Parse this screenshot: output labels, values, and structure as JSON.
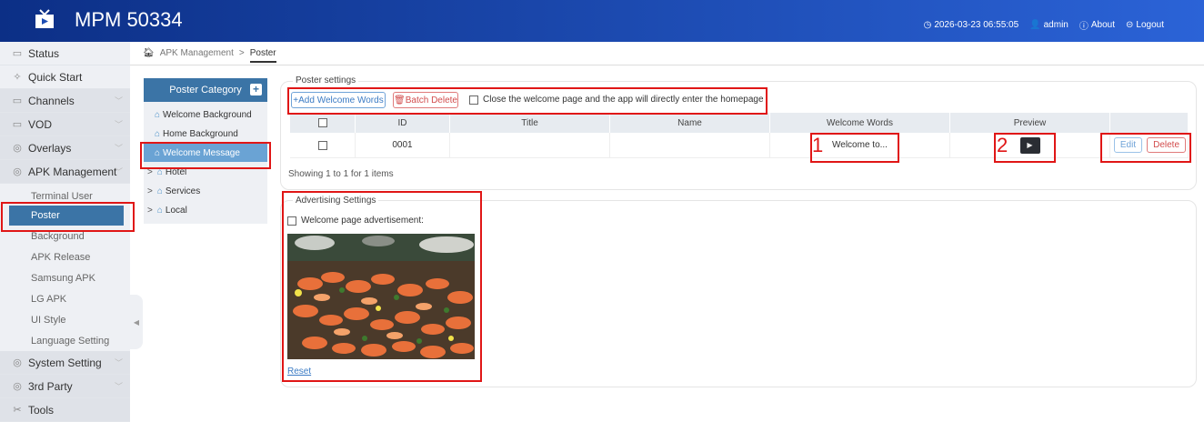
{
  "header": {
    "title": "MPM 50334",
    "datetime": "2026-03-23 06:55:05",
    "user": "admin",
    "about": "About",
    "logout": "Logout",
    "bg_colors": [
      "#0c2f86",
      "#2b63d7"
    ]
  },
  "sidebar": {
    "items": [
      {
        "label": "Status",
        "icon": "monitor-icon"
      },
      {
        "label": "Quick Start",
        "icon": "rocket-icon"
      },
      {
        "label": "Channels",
        "icon": "tv-icon"
      },
      {
        "label": "VOD",
        "icon": "video-icon"
      },
      {
        "label": "Overlays",
        "icon": "layers-icon"
      },
      {
        "label": "APK Management",
        "icon": "apk-icon"
      }
    ],
    "sub_items": [
      "Terminal User",
      "Poster",
      "Background",
      "APK Release",
      "Samsung APK",
      "LG APK",
      "UI Style",
      "Language Setting"
    ],
    "bottom_items": [
      {
        "label": "System Setting",
        "icon": "settings-icon"
      },
      {
        "label": "3rd Party",
        "icon": "plugin-icon"
      },
      {
        "label": "Tools",
        "icon": "tools-icon"
      }
    ]
  },
  "breadcrumb": {
    "parent": "APK Management",
    "separator": ">",
    "current": "Poster"
  },
  "category": {
    "title": "Poster Category",
    "items": [
      "Welcome Background",
      "Home Background",
      "Welcome Message",
      "Hotel",
      "Services",
      "Local"
    ]
  },
  "poster_settings": {
    "legend": "Poster settings",
    "add_label": "+Add Welcome Words",
    "batch_delete_label": "Batch Delete",
    "close_welcome_label": "Close the welcome page and the app will directly enter the homepage",
    "columns": [
      "",
      "ID",
      "Title",
      "Name",
      "Welcome Words",
      "Preview",
      ""
    ],
    "rows": [
      {
        "id": "0001",
        "title": "",
        "name": "",
        "welcome_words": "Welcome to...",
        "edit": "Edit",
        "delete": "Delete"
      }
    ],
    "showing": "Showing 1 to 1 for 1 items"
  },
  "advertising": {
    "legend": "Advertising Settings",
    "checkbox_label": "Welcome page advertisement:",
    "reset_label": "Reset"
  },
  "annotations": {
    "mark1": "1",
    "mark2": "2",
    "color": "#e01616"
  }
}
